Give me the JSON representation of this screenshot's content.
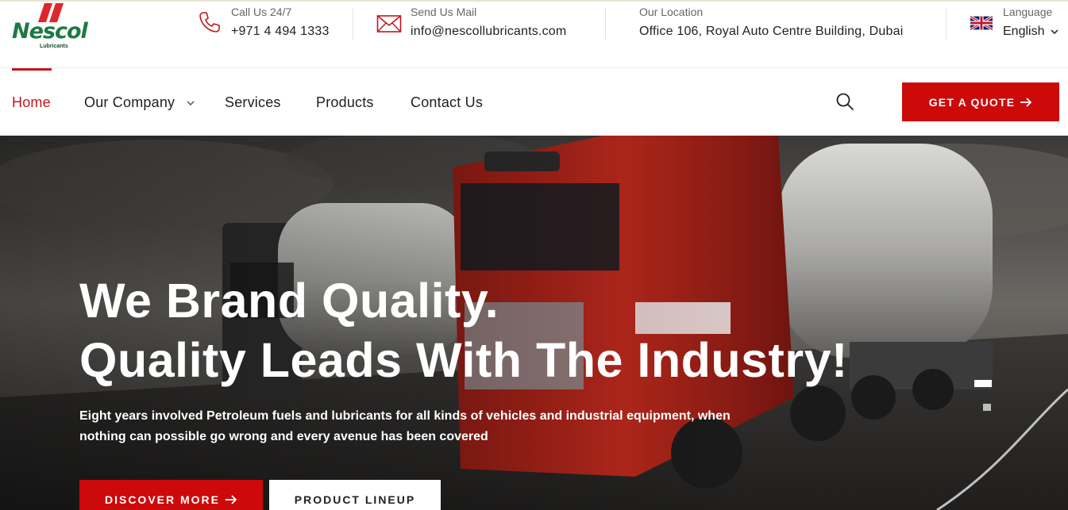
{
  "brand": {
    "name": "Nescol",
    "tagline": "Lubricants",
    "colors": {
      "accent": "#cc0a0a",
      "logo_green": "#1c7a44"
    }
  },
  "topbar": {
    "call": {
      "label": "Call Us 24/7",
      "value": "+971 4 494 1333",
      "icon": "phone-icon"
    },
    "mail": {
      "label": "Send Us Mail",
      "value": "info@nescollubricants.com",
      "icon": "mail-icon"
    },
    "location": {
      "label": "Our Location",
      "value": "Office 106, Royal Auto Centre Building, Dubai"
    },
    "language": {
      "label": "Language",
      "value": "English",
      "icon": "uk-flag-icon"
    }
  },
  "nav": {
    "items": [
      {
        "label": "Home",
        "active": true
      },
      {
        "label": "Our Company",
        "has_dropdown": true
      },
      {
        "label": "Services"
      },
      {
        "label": "Products"
      },
      {
        "label": "Contact Us"
      }
    ],
    "search_icon": "search-icon",
    "quote_button": "GET A QUOTE"
  },
  "hero": {
    "title_line1": "We Brand Quality.",
    "title_line2": "Quality Leads With The Industry!",
    "subtitle": "Eight years involved Petroleum fuels and lubricants for all kinds of vehicles and industrial equipment, when nothing can possible go wrong and every avenue has been covered",
    "primary_button": "DISCOVER MORE",
    "secondary_button": "PRODUCT LINEUP",
    "slide_count": 2,
    "active_slide": 1
  }
}
